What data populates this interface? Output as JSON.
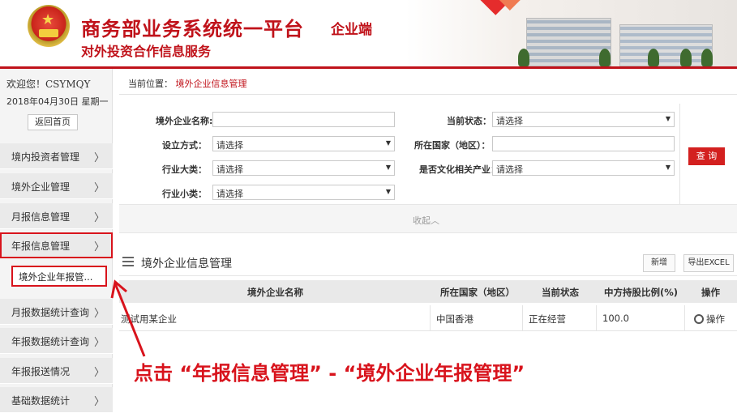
{
  "header": {
    "title": "商务部业务系统统一平台",
    "badge": "企业端",
    "subtitle": "对外投资合作信息服务"
  },
  "sidebar": {
    "welcome": "欢迎您！CSYMQY",
    "date": "2018年04月30日 星期一",
    "home_button": "返回首页",
    "items": [
      {
        "label": "境内投资者管理",
        "arrow": "〉"
      },
      {
        "label": "境外企业管理",
        "arrow": "〉"
      },
      {
        "label": "月报信息管理",
        "arrow": "〉"
      },
      {
        "label": "年报信息管理",
        "arrow": "〉"
      },
      {
        "label": "月报数据统计查询",
        "arrow": "〉"
      },
      {
        "label": "年报数据统计查询",
        "arrow": "〉"
      },
      {
        "label": "年报报送情况",
        "arrow": "〉"
      },
      {
        "label": "基础数据统计",
        "arrow": "〉"
      }
    ],
    "sub_item": "境外企业年报管..."
  },
  "breadcrumb": {
    "prefix": "当前位置：",
    "current": "境外企业信息管理"
  },
  "form": {
    "company_name_label": "境外企业名称:",
    "company_name_value": "",
    "status_label": "当前状态：",
    "status_value": "请选择",
    "setup_label": "设立方式：",
    "setup_value": "请选择",
    "country_label": "所在国家（地区）：",
    "country_value": "",
    "industry_label": "行业大类：",
    "industry_value": "请选择",
    "culture_label": "是否文化相关产业：",
    "culture_value": "请选择",
    "subindustry_label": "行业小类：",
    "subindustry_value": "请选择",
    "query_button": "查 询",
    "collapse": "收起︿"
  },
  "section": {
    "title": "境外企业信息管理",
    "new_button": "新增",
    "export_button": "导出EXCEL"
  },
  "table": {
    "headers": [
      "境外企业名称",
      "所在国家（地区）",
      "当前状态",
      "中方持股比例(%)",
      "操作"
    ],
    "rows": [
      {
        "name": "测试用某企业",
        "country": "中国香港",
        "status": "正在经营",
        "ratio": "100.0",
        "action": "操作"
      }
    ]
  },
  "annotation": "点击 “年报信息管理” - “境外企业年报管理”",
  "colors": {
    "brand_red": "#c0121a",
    "highlight_red": "#d8131c",
    "query_red": "#d3201f"
  }
}
